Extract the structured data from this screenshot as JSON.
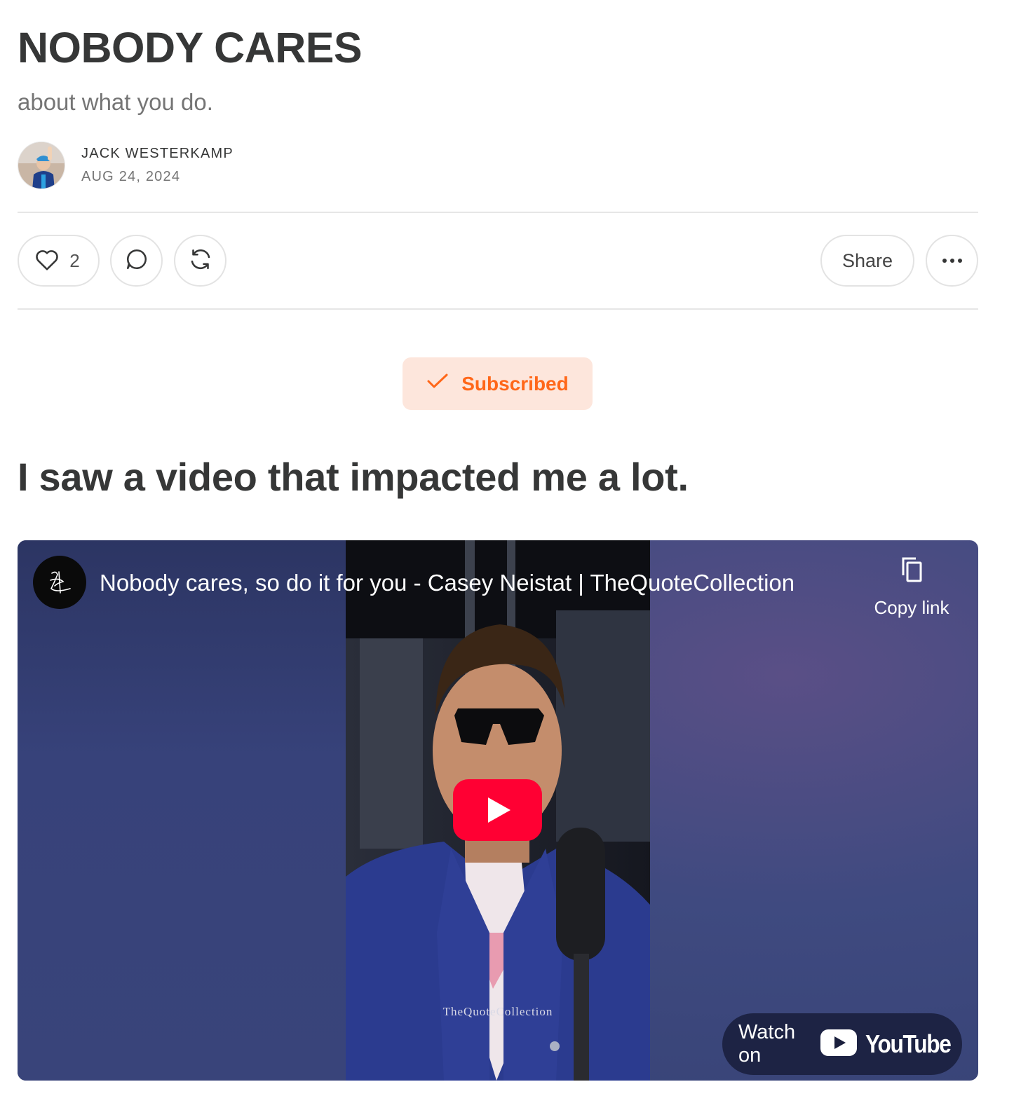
{
  "post": {
    "title": "NOBODY CARES",
    "subtitle": "about what you do.",
    "author": "JACK WESTERKAMP",
    "date": "AUG 24, 2024"
  },
  "actions": {
    "like_count": "2",
    "share_label": "Share"
  },
  "subscribe": {
    "label": "Subscribed"
  },
  "body": {
    "heading": "I saw a video that impacted me a lot."
  },
  "embed": {
    "video_title": "Nobody cares, so do it for you - Casey Neistat | TheQuoteCollection",
    "copy_link_label": "Copy link",
    "watermark": "TheQuoteCollection",
    "watch_on_label": "Watch on",
    "platform_name": "YouTube"
  },
  "colors": {
    "accent": "#ff6719",
    "accent_bg": "#fde6dc",
    "text": "#363737",
    "muted": "#757575",
    "youtube_red": "#ff0033"
  },
  "icons": [
    "heart-icon",
    "comment-icon",
    "restack-icon",
    "more-icon",
    "check-icon",
    "copy-icon",
    "play-icon",
    "youtube-logo-icon"
  ]
}
